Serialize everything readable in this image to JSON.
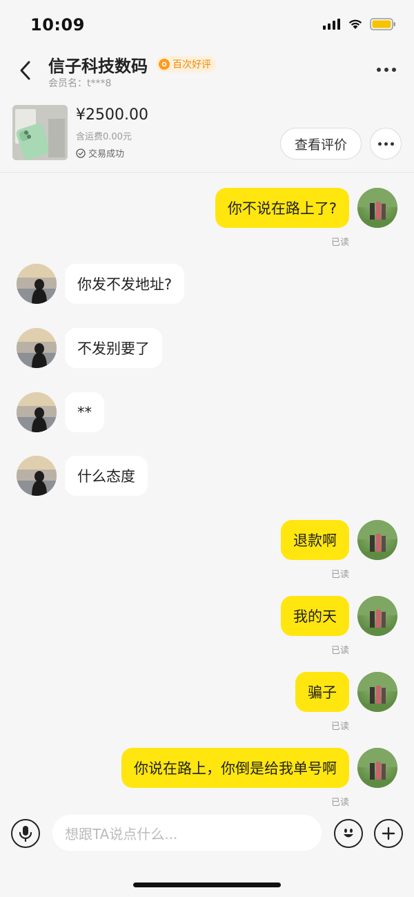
{
  "status_bar": {
    "time": "10:09",
    "icons": [
      "signal-icon",
      "wifi-icon",
      "battery-icon"
    ]
  },
  "header": {
    "shop_name": "信子科技数码",
    "badge": "百次好评",
    "member_label": "会员名：t***8",
    "icons": [
      "back-arrow-icon",
      "more-dots-icon"
    ]
  },
  "product": {
    "price": "¥2500.00",
    "shipping": "含运费0.00元",
    "status": "交易成功",
    "review_button": "查看评价"
  },
  "messages": [
    {
      "side": "mine",
      "text": "你不说在路上了?",
      "read": "已读"
    },
    {
      "side": "theirs",
      "text": "你发不发地址?"
    },
    {
      "side": "theirs",
      "text": "不发别要了"
    },
    {
      "side": "theirs",
      "text": "**"
    },
    {
      "side": "theirs",
      "text": "什么态度"
    },
    {
      "side": "mine",
      "text": "退款啊",
      "read": "已读"
    },
    {
      "side": "mine",
      "text": "我的天",
      "read": "已读"
    },
    {
      "side": "mine",
      "text": "骗子",
      "read": "已读"
    },
    {
      "side": "mine",
      "text": "你说在路上，你倒是给我单号啊",
      "read": "已读"
    }
  ],
  "input": {
    "placeholder": "想跟TA说点什么...",
    "icons": [
      "microphone-icon",
      "emoji-icon",
      "plus-icon"
    ]
  },
  "colors": {
    "my_bubble": "#ffe60f",
    "their_bubble": "#ffffff",
    "badge_text": "#f08a00",
    "background": "#f6f6f6"
  }
}
